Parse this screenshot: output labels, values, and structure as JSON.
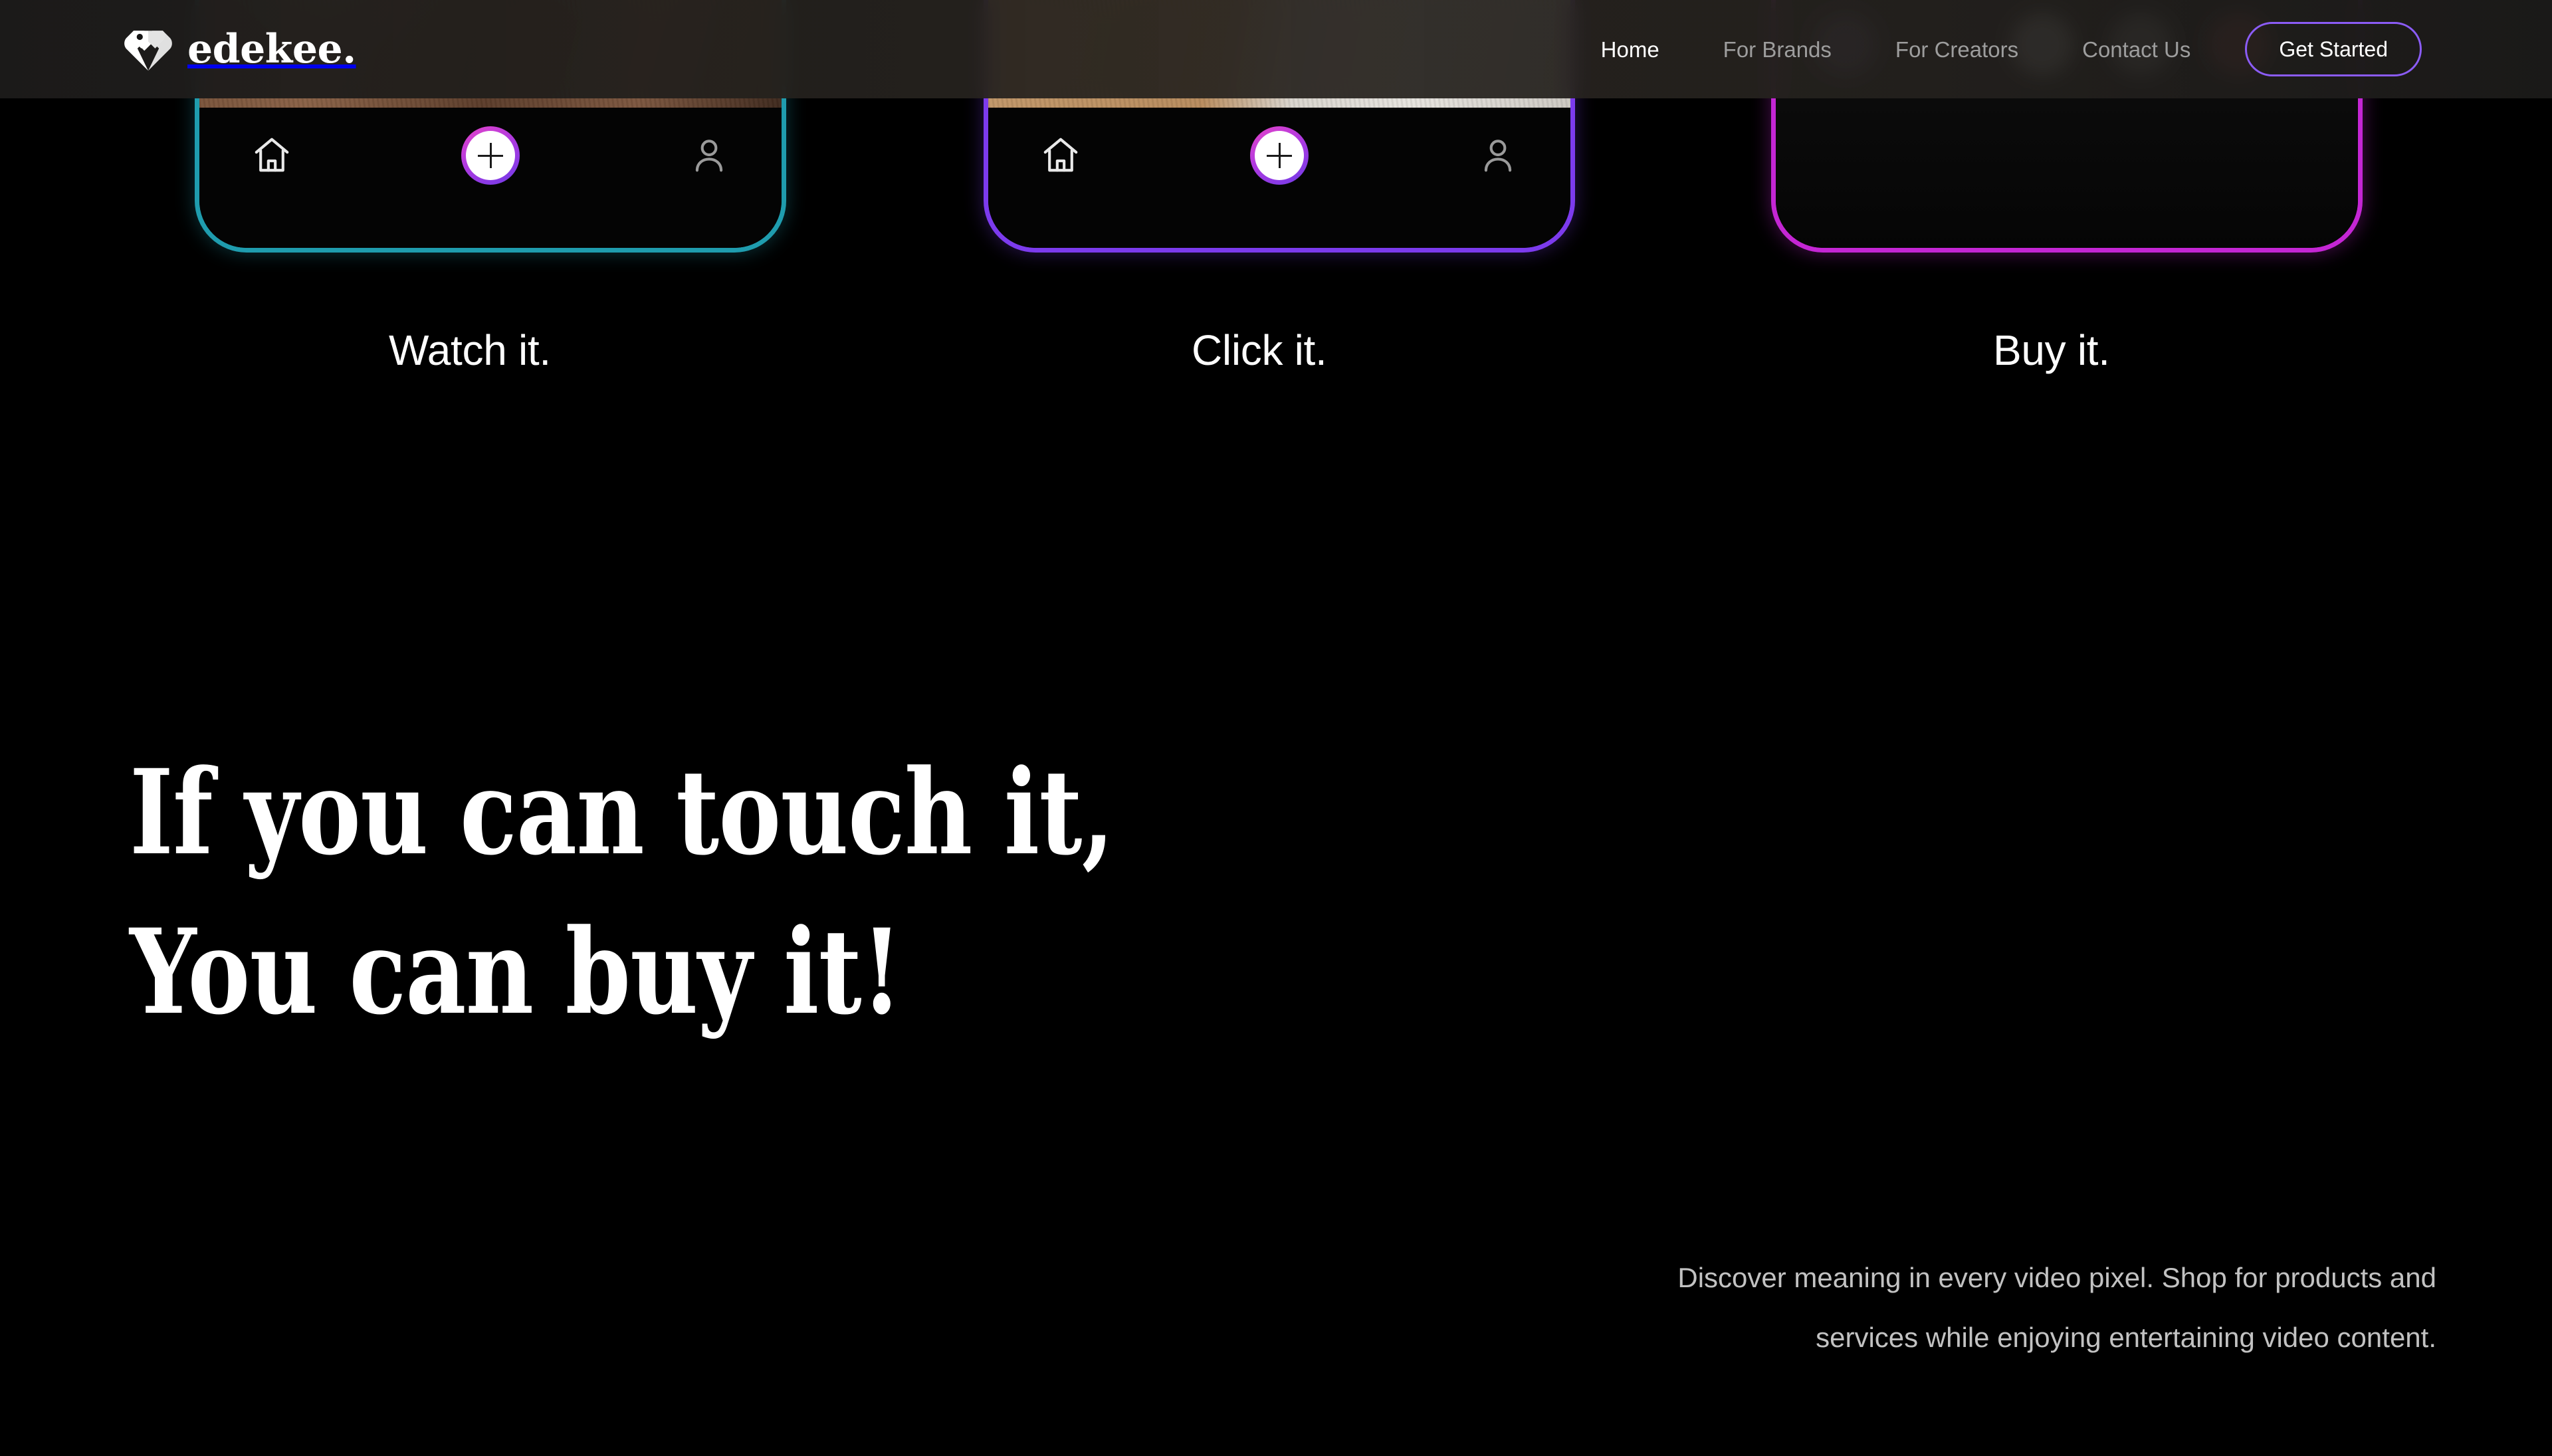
{
  "brand": {
    "name": "edekee.",
    "logo_icon": "heart-tag-icon"
  },
  "header": {
    "nav": [
      {
        "label": "Home",
        "active": true
      },
      {
        "label": "For Brands",
        "active": false
      },
      {
        "label": "For Creators",
        "active": false
      },
      {
        "label": "Contact Us",
        "active": false
      }
    ],
    "cta_label": "Get Started",
    "cta_border_color": "#8b5cf6"
  },
  "showcase": {
    "phones": [
      {
        "caption": "Watch it.",
        "border_color": "#1f9cae",
        "screen_type": "video-feed",
        "nav": {
          "home_icon": "home-icon",
          "add_icon": "plus-icon",
          "profile_icon": "person-icon"
        }
      },
      {
        "caption": "Click it.",
        "border_color": "#7c3bed",
        "screen_type": "video-feed",
        "nav": {
          "home_icon": "home-icon",
          "add_icon": "plus-icon",
          "profile_icon": "person-icon"
        }
      },
      {
        "caption": "Buy it.",
        "border_color": "#c426d4",
        "screen_type": "product-colors",
        "swatches": [
          "#6f5f8e",
          "#0a0a0a",
          "#ffffff",
          "#cdcdc8",
          "#e85c5c"
        ],
        "next_arrow": "›"
      }
    ]
  },
  "hero": {
    "headline_line_1": "If you can touch it,",
    "headline_line_2": "You can buy it!",
    "paragraph_line_1": "Discover meaning in every video pixel. Shop for products and",
    "paragraph_line_2": "services while enjoying entertaining video content."
  }
}
